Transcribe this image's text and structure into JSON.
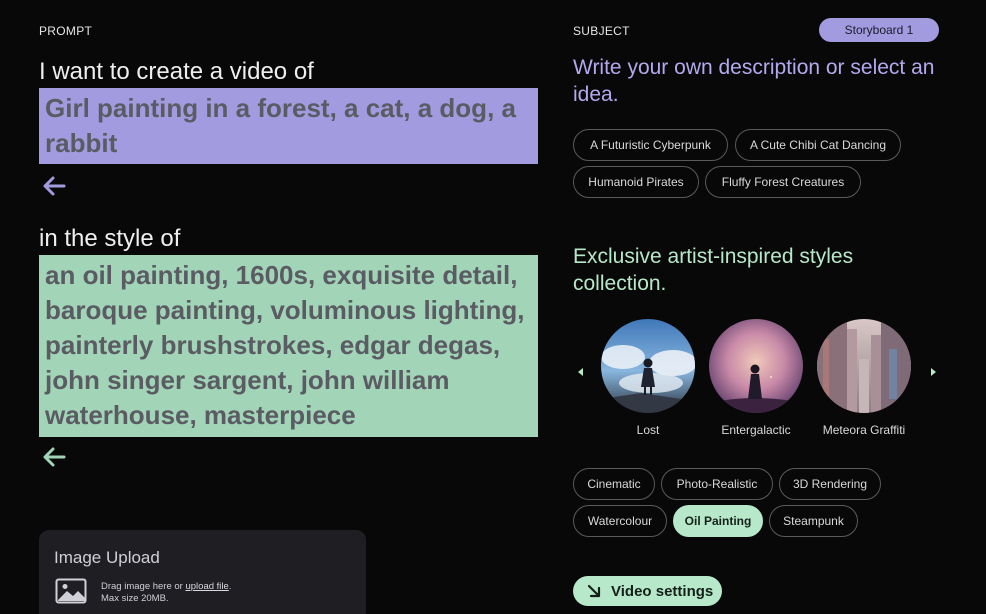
{
  "prompt": {
    "section_label": "PROMPT",
    "subject_lead": "I want to create a video of",
    "subject_text": "Girl painting in a forest, a cat, a dog, a rabbit",
    "style_lead": "in the style of",
    "style_text": "an oil painting, 1600s, exquisite detail, baroque painting, voluminous lighting, painterly brushstrokes, edgar degas, john singer sargent, john william waterhouse, masterpiece"
  },
  "upload": {
    "title": "Image Upload",
    "drag_text": "Drag image here or ",
    "link_text": "upload file",
    "drag_suffix": ".",
    "max_size": "Max size 20MB."
  },
  "subject": {
    "section_label": "SUBJECT",
    "storyboard_label": "Storyboard 1",
    "heading": "Write your own description or select an idea.",
    "ideas": [
      "A Futuristic Cyberpunk",
      "A Cute Chibi Cat Dancing",
      "Humanoid Pirates",
      "Fluffy Forest Creatures"
    ]
  },
  "styles": {
    "heading": "Exclusive artist-inspired styles collection.",
    "collection": [
      "Lost",
      "Entergalactic",
      "Meteora Graffiti"
    ],
    "chips": [
      "Cinematic",
      "Photo-Realistic",
      "3D Rendering",
      "Watercolour",
      "Oil Painting",
      "Steampunk"
    ],
    "selected_chip": "Oil Painting"
  },
  "video_settings_label": "Video settings",
  "colors": {
    "background": "#080808",
    "accent_purple": "#a39be0",
    "accent_green": "#b6e8c9"
  },
  "icons": [
    "back-arrow-icon",
    "image-icon",
    "chevron-left-icon",
    "chevron-right-icon",
    "arrow-down-right-icon"
  ]
}
